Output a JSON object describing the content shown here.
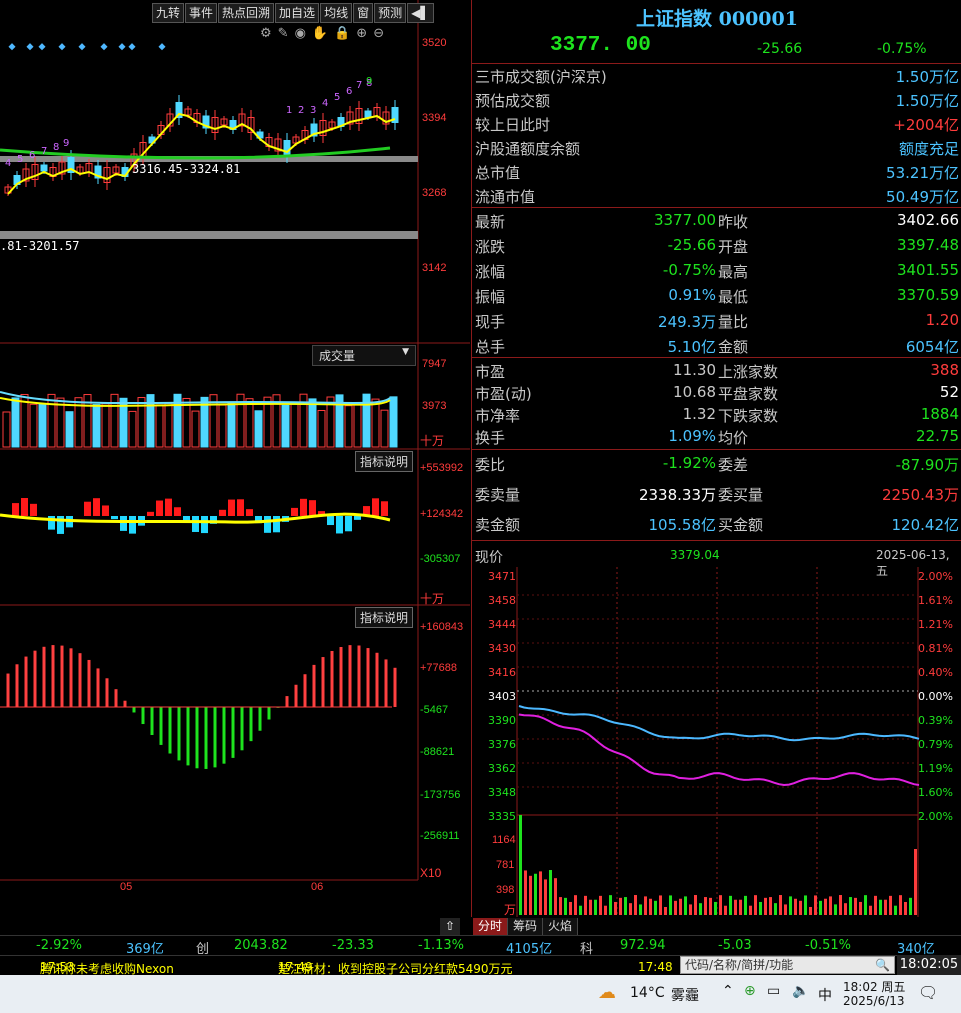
{
  "toolbar": {
    "buttons": [
      "九转",
      "事件",
      "热点回溯",
      "加自选",
      "均线",
      "窗",
      "预测"
    ]
  },
  "kline": {
    "price_axis": [
      "3520",
      "3394",
      "3268",
      "3142"
    ],
    "range_label_1": "3316.45-3324.81",
    "range_label_2": ".81-3201.57",
    "td_numbers": [
      "4",
      "5",
      "6",
      "7",
      "8",
      "9",
      "1",
      "2",
      "3",
      "4",
      "5",
      "6",
      "7",
      "8",
      "9"
    ]
  },
  "volume": {
    "selector": "成交量",
    "axis": [
      "7947",
      "3973"
    ],
    "unit": "十万"
  },
  "indicator1": {
    "button": "指标说明",
    "axis": [
      "+553992",
      "+124342",
      "-305307"
    ],
    "unit": "十万"
  },
  "indicator2": {
    "button": "指标说明",
    "axis": [
      "+160843",
      "+77688",
      "-5467",
      "-88621",
      "-173756",
      "-256911"
    ],
    "unit": "X10"
  },
  "date_axis": [
    "05",
    "06"
  ],
  "quote": {
    "title": "上证指数 000001",
    "price": "3377. 00",
    "change": "-25.66",
    "pct": "-0.75%"
  },
  "summary": [
    {
      "label": "三市成交额(沪深京)",
      "value": "1.50万亿",
      "color": "cyan"
    },
    {
      "label": "预估成交额",
      "value": "1.50万亿",
      "color": "cyan"
    },
    {
      "label": "较上日此时",
      "value": "+2004亿",
      "color": "red"
    },
    {
      "label": "沪股通额度余额",
      "value": "额度充足",
      "color": "cyan"
    },
    {
      "label": "总市值",
      "value": "53.21万亿",
      "color": "cyan"
    },
    {
      "label": "流通市值",
      "value": "50.49万亿",
      "color": "cyan"
    }
  ],
  "stats": [
    {
      "l1": "最新",
      "v1": "3377.00",
      "c1": "green",
      "l2": "昨收",
      "v2": "3402.66",
      "c2": "white"
    },
    {
      "l1": "涨跌",
      "v1": "-25.66",
      "c1": "green",
      "l2": "开盘",
      "v2": "3397.48",
      "c2": "green"
    },
    {
      "l1": "涨幅",
      "v1": "-0.75%",
      "c1": "green",
      "l2": "最高",
      "v2": "3401.55",
      "c2": "green"
    },
    {
      "l1": "振幅",
      "v1": "0.91%",
      "c1": "cyan",
      "l2": "最低",
      "v2": "3370.59",
      "c2": "green"
    },
    {
      "l1": "现手",
      "v1": "249.3万",
      "c1": "cyan",
      "l2": "量比",
      "v2": "1.20",
      "c2": "red"
    },
    {
      "l1": "总手",
      "v1": "5.10亿",
      "c1": "cyan",
      "l2": "金额",
      "v2": "6054亿",
      "c2": "cyan"
    }
  ],
  "stats2": [
    {
      "l1": "市盈",
      "v1": "11.30",
      "c1": "label",
      "l2": "上涨家数",
      "v2": "388",
      "c2": "red"
    },
    {
      "l1": "市盈(动)",
      "v1": "10.68",
      "c1": "label",
      "l2": "平盘家数",
      "v2": "52",
      "c2": "white"
    },
    {
      "l1": "市净率",
      "v1": "1.32",
      "c1": "label",
      "l2": "下跌家数",
      "v2": "1884",
      "c2": "green"
    },
    {
      "l1": "换手",
      "v1": "1.09%",
      "c1": "cyan",
      "l2": "均价",
      "v2": "22.75",
      "c2": "green"
    }
  ],
  "order": [
    {
      "l1": "委比",
      "v1": "-1.92%",
      "c1": "green",
      "l2": "委差",
      "v2": "-87.90万",
      "c2": "green"
    },
    {
      "l1": "委卖量",
      "v1": "2338.33万",
      "c1": "white",
      "l2": "委买量",
      "v2": "2250.43万",
      "c2": "red"
    },
    {
      "l1": "卖金额",
      "v1": "105.58亿",
      "c1": "cyan",
      "l2": "买金额",
      "v2": "120.42亿",
      "c2": "cyan"
    }
  ],
  "intraday": {
    "label": "现价",
    "price": "3379.04",
    "date": "2025-06-13,五",
    "left_axis": [
      "3471",
      "3458",
      "3444",
      "3430",
      "3416",
      "3403",
      "3390",
      "3376",
      "3362",
      "3348",
      "3335"
    ],
    "right_axis": [
      "2.00%",
      "1.61%",
      "1.21%",
      "0.81%",
      "0.40%",
      "0.00%",
      "0.39%",
      "0.79%",
      "1.19%",
      "1.60%",
      "2.00%"
    ],
    "vol_axis": [
      "1164",
      "781",
      "398"
    ],
    "vol_unit": "万"
  },
  "tabs": [
    "分时",
    "筹码",
    "火焰"
  ],
  "status": {
    "pct1": "-2.92%",
    "amt1": "369亿",
    "name2": "创",
    "price2": "2043.82",
    "chg2": "-23.33",
    "pct2": "-1.13%",
    "amt2": "4105亿",
    "name3": "科",
    "price3": "972.94",
    "chg3": "-5.03",
    "pct3": "-0.51%",
    "amt3": "340亿"
  },
  "news": [
    {
      "time": "17:53",
      "text": "腾讯称未考虑收购Nexon"
    },
    {
      "time": "17:49",
      "text": "楚江新材：收到控股子公司分红款5490万元"
    },
    {
      "time": "17:48",
      "text": ""
    }
  ],
  "search_placeholder": "代码/名称/简拼/功能",
  "clock": "18:02:05",
  "taskbar": {
    "temp": "14°C",
    "weather": "雾霾",
    "ime": "中",
    "time": "18:02 周五",
    "date": "2025/6/13"
  }
}
